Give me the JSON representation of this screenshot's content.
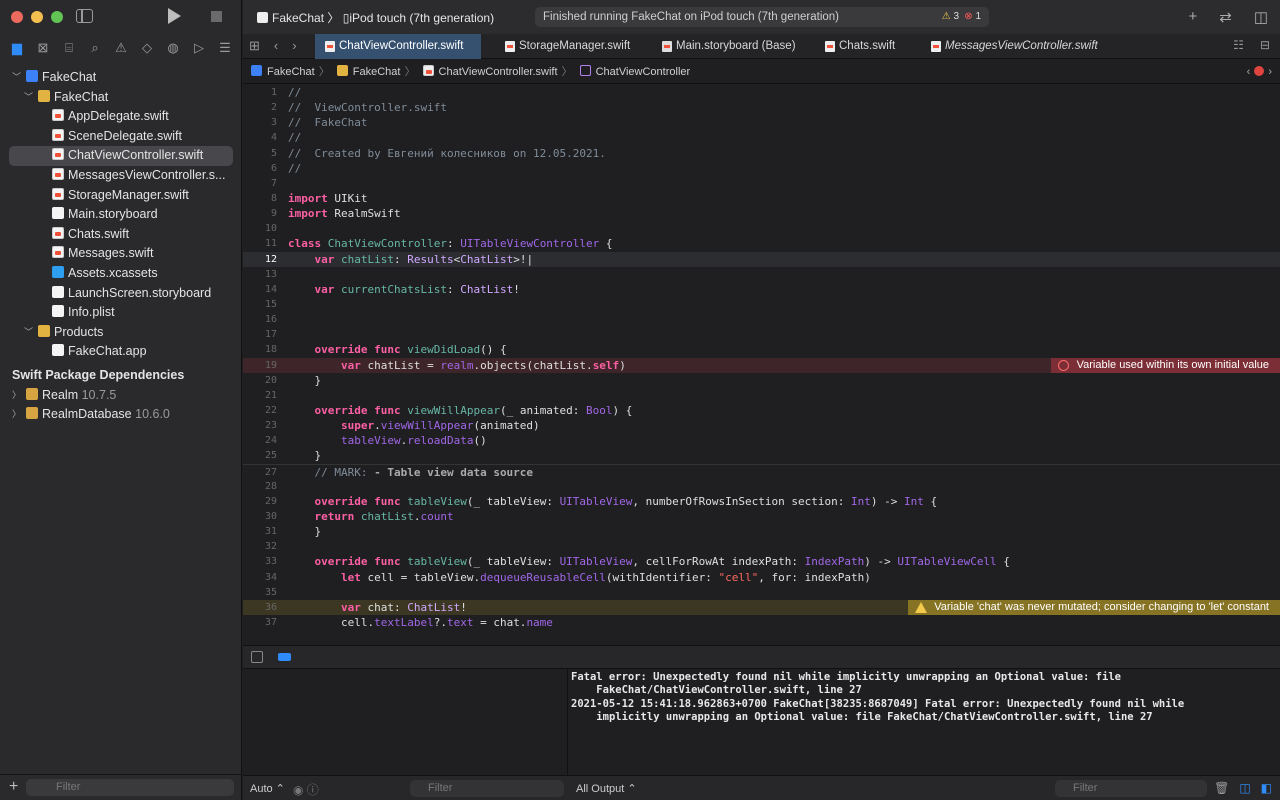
{
  "toolbar": {
    "scheme": "FakeChat",
    "scheme_sep": "〉",
    "device": "iPod touch (7th generation)",
    "status": "Finished running FakeChat on iPod touch (7th generation)",
    "warnings": "3",
    "errors": "1"
  },
  "tree": {
    "project": "FakeChat",
    "group": "FakeChat",
    "files": [
      "AppDelegate.swift",
      "SceneDelegate.swift",
      "ChatViewController.swift",
      "MessagesViewController.s...",
      "StorageManager.swift",
      "Main.storyboard",
      "Chats.swift",
      "Messages.swift",
      "Assets.xcassets",
      "LaunchScreen.storyboard",
      "Info.plist"
    ],
    "products": "Products",
    "product_app": "FakeChat.app",
    "spm_header": "Swift Package Dependencies",
    "pkg1": "Realm",
    "pkg1_ver": "10.7.5",
    "pkg2": "RealmDatabase",
    "pkg2_ver": "10.6.0"
  },
  "sidebar_filter": "Filter",
  "tabs": [
    "ChatViewController.swift",
    "StorageManager.swift",
    "Main.storyboard (Base)",
    "Chats.swift",
    "MessagesViewController.swift"
  ],
  "breadcrumb": [
    "FakeChat",
    "FakeChat",
    "ChatViewController.swift",
    "ChatViewController"
  ],
  "diagnostics": {
    "error": "Variable used within its own initial value",
    "warning": "Variable 'chat' was never mutated; consider changing to 'let' constant"
  },
  "console": {
    "line1": "Fatal error: Unexpectedly found nil while implicitly unwrapping an Optional value: file\n    FakeChat/ChatViewController.swift, line 27",
    "line2": "2021-05-12 15:41:18.962863+0700 FakeChat[38235:8687049] Fatal error: Unexpectedly found nil while\n    implicitly unwrapping an Optional value: file FakeChat/ChatViewController.swift, line 27"
  },
  "debug": {
    "auto": "Auto ⌃",
    "var_filter": "Filter",
    "output": "All Output ⌃",
    "console_filter": "Filter"
  }
}
